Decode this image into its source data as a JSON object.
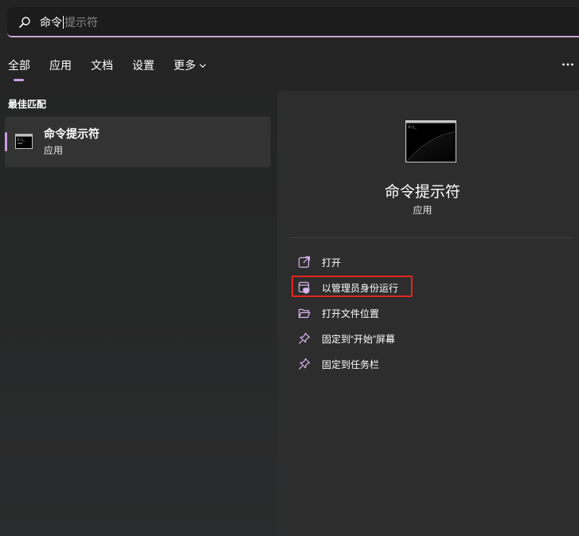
{
  "search": {
    "typed": "命令",
    "suggestion": "提示符"
  },
  "tabs": [
    {
      "label": "全部",
      "active": true
    },
    {
      "label": "应用",
      "active": false
    },
    {
      "label": "文档",
      "active": false
    },
    {
      "label": "设置",
      "active": false
    },
    {
      "label": "更多",
      "active": false
    }
  ],
  "best_match": {
    "section_title": "最佳匹配",
    "name": "命令提示符",
    "type": "应用"
  },
  "detail": {
    "title": "命令提示符",
    "type": "应用",
    "actions": [
      {
        "label": "打开",
        "icon": "open-external-icon"
      },
      {
        "label": "以管理员身份运行",
        "icon": "run-as-admin-icon",
        "highlighted": true
      },
      {
        "label": "打开文件位置",
        "icon": "folder-open-icon"
      },
      {
        "label": "固定到“开始”屏幕",
        "icon": "pin-icon"
      },
      {
        "label": "固定到任务栏",
        "icon": "pin-icon"
      }
    ]
  },
  "colors": {
    "accent": "#c99de0",
    "highlight_box": "#e3251b",
    "background": "#202020",
    "panel": "#2d2d2e"
  }
}
